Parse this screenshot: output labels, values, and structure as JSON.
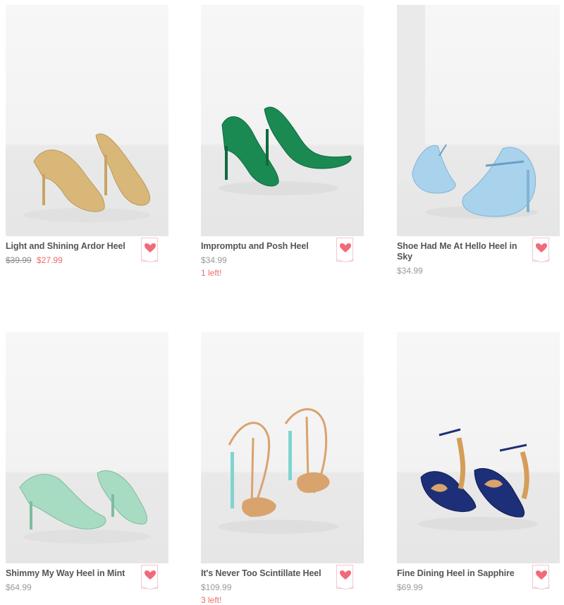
{
  "products": [
    {
      "name": "Light and Shining Ardor Heel",
      "original_price": "$39.99",
      "sale_price": "$27.99",
      "price": "",
      "stock": "",
      "wishlist_icon": "heart-icon",
      "shoe_color": "#d8b779"
    },
    {
      "name": "Impromptu and Posh Heel",
      "original_price": "",
      "sale_price": "",
      "price": "$34.99",
      "stock": "1 left!",
      "wishlist_icon": "heart-icon",
      "shoe_color": "#1a8a52"
    },
    {
      "name": "Shoe Had Me At Hello Heel in Sky",
      "original_price": "",
      "sale_price": "",
      "price": "$34.99",
      "stock": "",
      "wishlist_icon": "heart-icon",
      "shoe_color": "#a9d2ec"
    },
    {
      "name": "Shimmy My Way Heel in Mint",
      "original_price": "",
      "sale_price": "",
      "price": "$64.99",
      "stock": "",
      "wishlist_icon": "heart-icon",
      "shoe_color": "#a7dcc2"
    },
    {
      "name": "It's Never Too Scintillate Heel",
      "original_price": "",
      "sale_price": "",
      "price": "$109.99",
      "stock": "3 left!",
      "wishlist_icon": "heart-icon",
      "shoe_color": "#d9a36d"
    },
    {
      "name": "Fine Dining Heel in Sapphire",
      "original_price": "",
      "sale_price": "",
      "price": "$69.99",
      "stock": "",
      "wishlist_icon": "heart-icon",
      "shoe_color": "#1d2f78"
    }
  ],
  "colors": {
    "sale": "#f06a6a",
    "heart": "#f26a7a",
    "badge_border": "#f4c7cc",
    "name_text": "#555555",
    "price_text": "#9a9a9a"
  }
}
